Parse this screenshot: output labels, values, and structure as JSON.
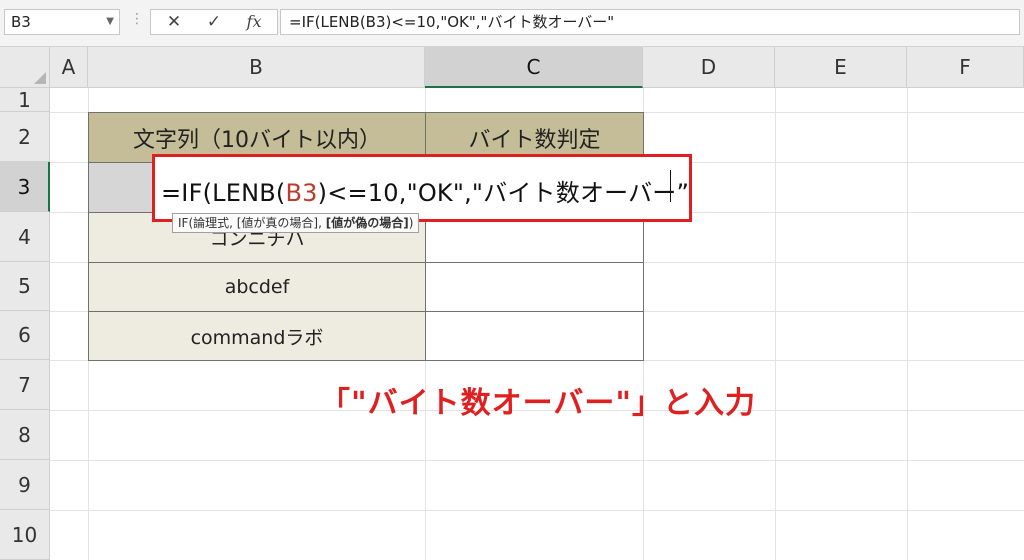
{
  "formula_bar": {
    "name_box": "B3",
    "cancel_icon": "✕",
    "enter_icon": "✓",
    "fx_label": "fx",
    "formula": "=IF(LENB(B3)<=10,\"OK\",\"バイト数オーバー\""
  },
  "columns": [
    "A",
    "B",
    "C",
    "D",
    "E",
    "F"
  ],
  "rows": [
    "1",
    "2",
    "3",
    "4",
    "5",
    "6",
    "7",
    "8",
    "9",
    "10"
  ],
  "table": {
    "header_b": "文字列（10バイト以内）",
    "header_c": "バイト数判定",
    "b4": "コンニチハ",
    "b5": "abcdef",
    "b6": "commandラボ"
  },
  "editor": {
    "part_before_ref": "=IF(LENB(",
    "ref": "B3",
    "part_after_ref": ")<=10,\"OK\",\"バイト数オーバー”"
  },
  "tooltip": {
    "prefix": "IF(論理式, [値が真の場合], ",
    "bold_arg": "[値が偽の場合]",
    "suffix": ")"
  },
  "annotation": "「\"バイト数オーバー\"」と入力",
  "colors": {
    "accent_green": "#1e7145",
    "annotation_red": "#e02020",
    "header_fill": "#c4bd97",
    "data_fill": "#eeebe0"
  }
}
